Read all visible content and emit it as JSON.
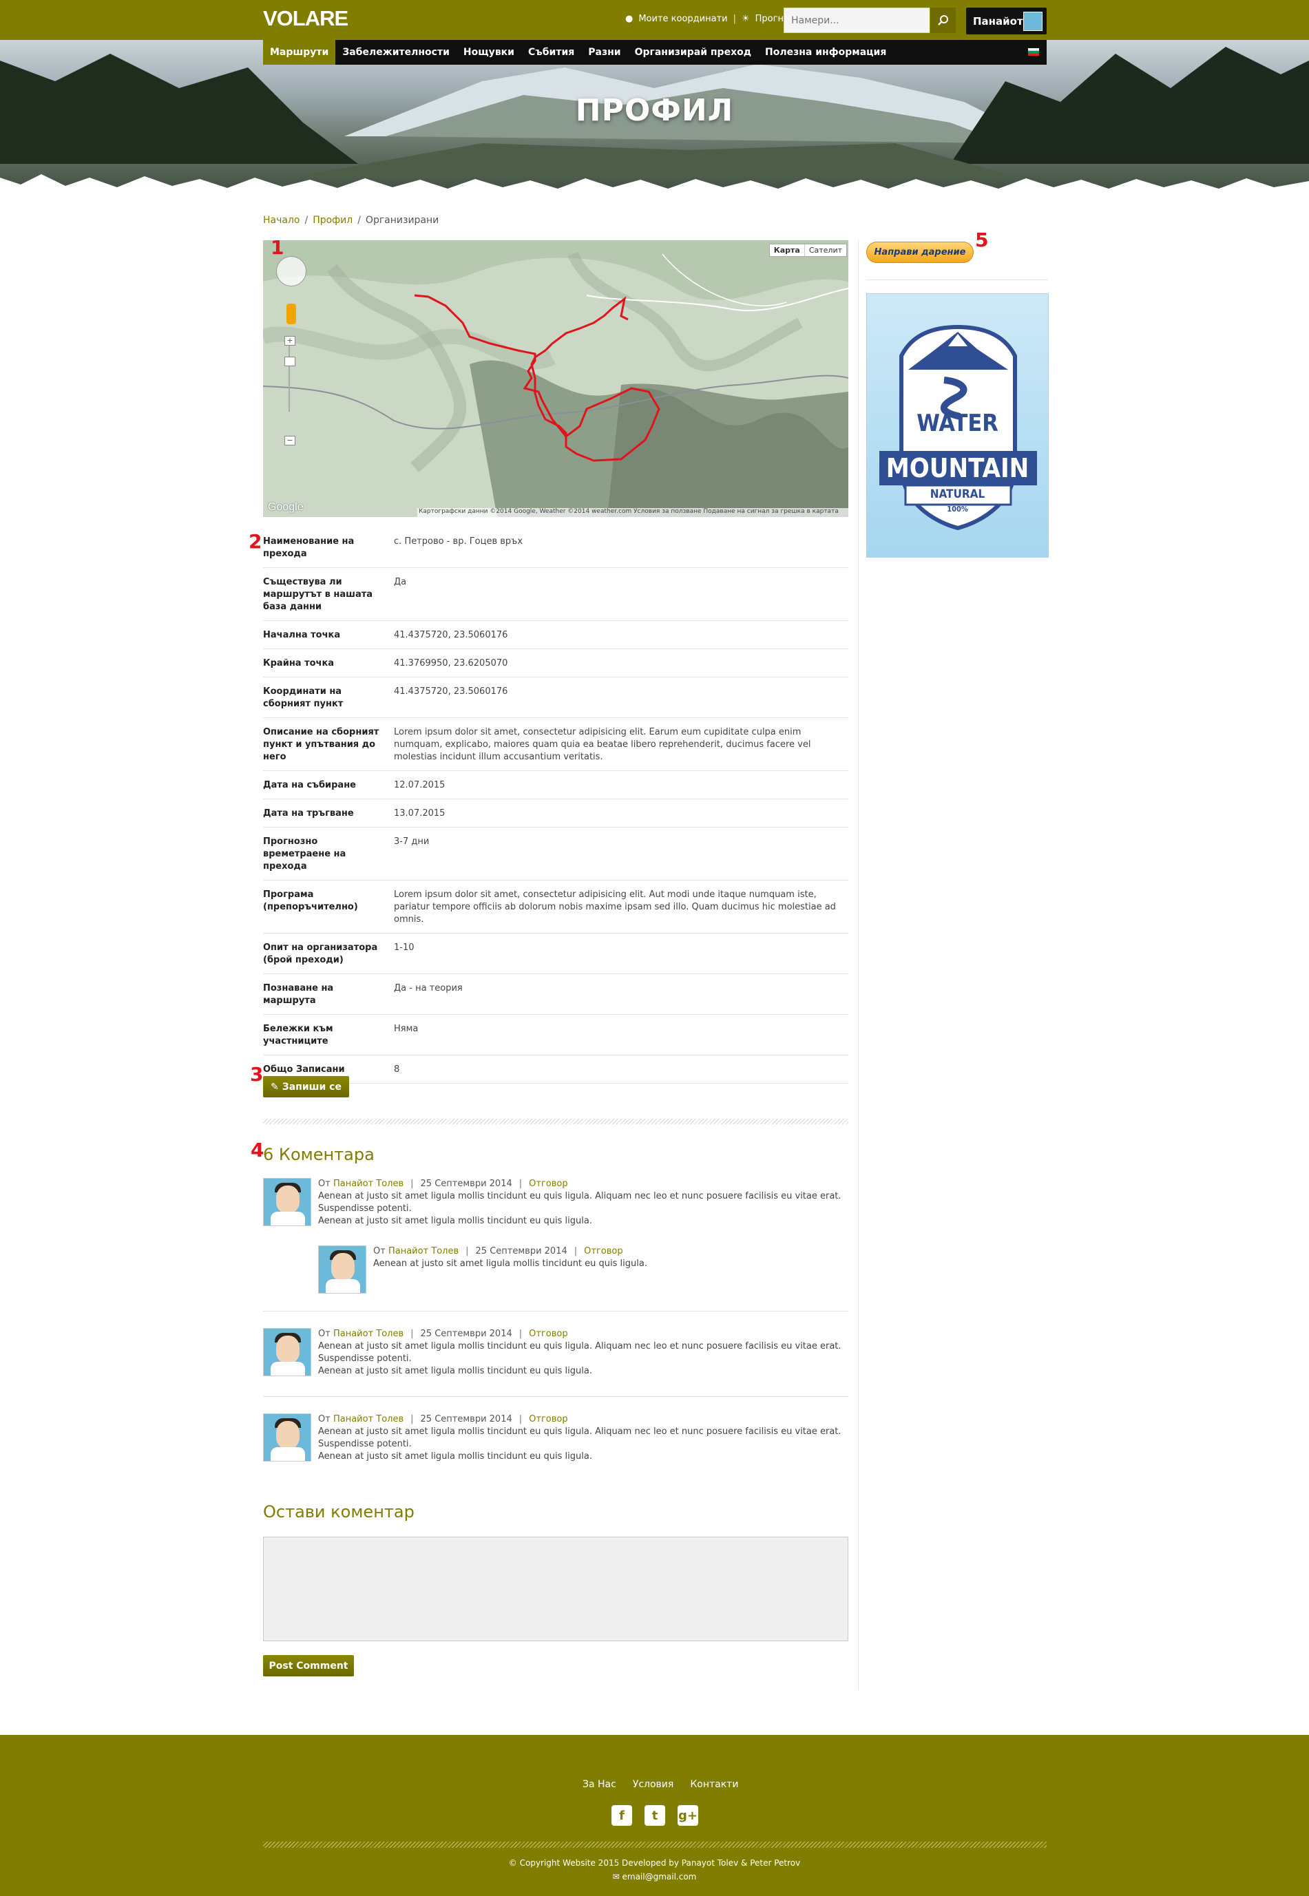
{
  "header": {
    "logo": "VOLARE",
    "coords_link": "Моите координати",
    "separator": "|",
    "forecast_link": "Прогноза",
    "search_placeholder": "Намери...",
    "user_name": "Панайот"
  },
  "nav": {
    "items": [
      "Маршрути",
      "Забележителности",
      "Нощувки",
      "Събития",
      "Разни",
      "Организирай преход",
      "Полезна информация"
    ],
    "active_index": 0
  },
  "hero": {
    "title": "ПРОФИЛ"
  },
  "breadcrumb": {
    "home": "Начало",
    "profile": "Профил",
    "current": "Организирани"
  },
  "map": {
    "type_map": "Карта",
    "type_satellite": "Сателит",
    "attribution": "Картографски данни ©2014 Google, Weather ©2014 weather.com     Условия за ползване     Подаване на сигнал за грешка в картата",
    "logo": "Google",
    "zoom_in": "+",
    "zoom_out": "−"
  },
  "annotations": [
    "1",
    "2",
    "3",
    "4",
    "5"
  ],
  "details": [
    {
      "label": "Наименование на прехода",
      "value": "с. Петрово - вр. Гоцев връх"
    },
    {
      "label": "Съществува ли маршрутът в нашата база данни",
      "value": "Да"
    },
    {
      "label": "Начална точка",
      "value": "41.4375720, 23.5060176"
    },
    {
      "label": "Крайна точка",
      "value": "41.3769950, 23.6205070"
    },
    {
      "label": "Координати на сборният пункт",
      "value": "41.4375720, 23.5060176"
    },
    {
      "label": "Описание на сборният пункт и упътвания до него",
      "value": "Lorem ipsum dolor sit amet, consectetur adipisicing elit. Earum eum cupiditate culpa enim numquam, explicabo, maiores quam quia ea beatae libero reprehenderit, ducimus facere vel molestias incidunt illum accusantium veritatis."
    },
    {
      "label": "Дата на събиране",
      "value": "12.07.2015"
    },
    {
      "label": "Дата на тръгване",
      "value": "13.07.2015"
    },
    {
      "label": "Прогнозно времетраене на прехода",
      "value": "3-7 дни"
    },
    {
      "label": "Програма (препоръчително)",
      "value": "Lorem ipsum dolor sit amet, consectetur adipisicing elit. Aut modi unde itaque numquam iste, pariatur tempore officiis ab dolorum nobis maxime ipsam sed illo. Quam ducimus hic molestiae ad omnis."
    },
    {
      "label": "Опит на организатора (брой преходи)",
      "value": "1-10"
    },
    {
      "label": "Познаване на маршрута",
      "value": "Да - на теория"
    },
    {
      "label": "Бележки към участниците",
      "value": "Няма"
    },
    {
      "label": "Общо Записани",
      "value": "8"
    }
  ],
  "signup_button": "Запиши се",
  "comments": {
    "title": "6 Коментара",
    "by": "От",
    "author": "Панайот Толев",
    "date": "25 Септември 2014",
    "reply": "Отговор",
    "bar": "|",
    "text_long_1": "Aenean at justo sit amet ligula mollis tincidunt eu quis ligula. Aliquam nec leo et nunc posuere facilisis eu vitae erat. Suspendisse potenti.",
    "text_short": "Aenean at justo sit amet ligula mollis tincidunt eu quis ligula."
  },
  "leave_comment": {
    "title": "Остави коментар",
    "button": "Post Comment"
  },
  "sidebar": {
    "donate": "Направи дарение",
    "ad_water": "WATER",
    "ad_mountain": "MOUNTAIN",
    "ad_natural": "NATURAL",
    "ad_percent": "100%"
  },
  "footer": {
    "links": [
      "За Нас",
      "Условия",
      "Контакти"
    ],
    "social": [
      "f",
      "t",
      "g+"
    ],
    "copyright": "© Copyright Website 2015     Developed by Panayot Tolev & Peter Petrov",
    "email": "email@gmail.com"
  },
  "colors": {
    "brand": "#817d00",
    "accent_link": "#817d00",
    "annotation": "#e3141b",
    "route": "#e0141b"
  }
}
